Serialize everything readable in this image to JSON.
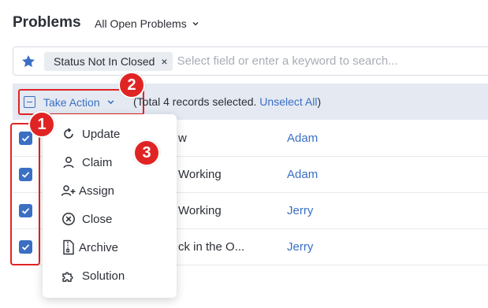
{
  "header": {
    "title": "Problems",
    "view_label": "All Open Problems"
  },
  "search": {
    "filter_chip": "Status Not In Closed",
    "chip_remove": "×",
    "placeholder": "Select field or enter a keyword to search..."
  },
  "action_bar": {
    "take_action_label": "Take Action",
    "selected_prefix": "(Total 4 records selected. ",
    "unselect_label": "Unselect All",
    "selected_suffix": ")"
  },
  "rows": [
    {
      "title": "w",
      "owner": "Adam",
      "checked": true
    },
    {
      "title": "Working",
      "owner": "Adam",
      "checked": true
    },
    {
      "title": "Working",
      "owner": "Jerry",
      "checked": true
    },
    {
      "title": "ck in the O...",
      "owner": "Jerry",
      "checked": true
    }
  ],
  "menu": {
    "items": [
      {
        "label": "Update",
        "icon": "refresh-icon"
      },
      {
        "label": "Claim",
        "icon": "user-icon"
      },
      {
        "label": "Assign",
        "icon": "user-plus-icon"
      },
      {
        "label": "Close",
        "icon": "close-circle-icon"
      },
      {
        "label": "Archive",
        "icon": "archive-file-icon"
      },
      {
        "label": "Solution",
        "icon": "puzzle-icon"
      }
    ]
  },
  "annotations": [
    "1",
    "2",
    "3"
  ],
  "colors": {
    "accent": "#3a6fc4",
    "highlight": "#e02424",
    "action_bar_bg": "#e4e9f2"
  }
}
